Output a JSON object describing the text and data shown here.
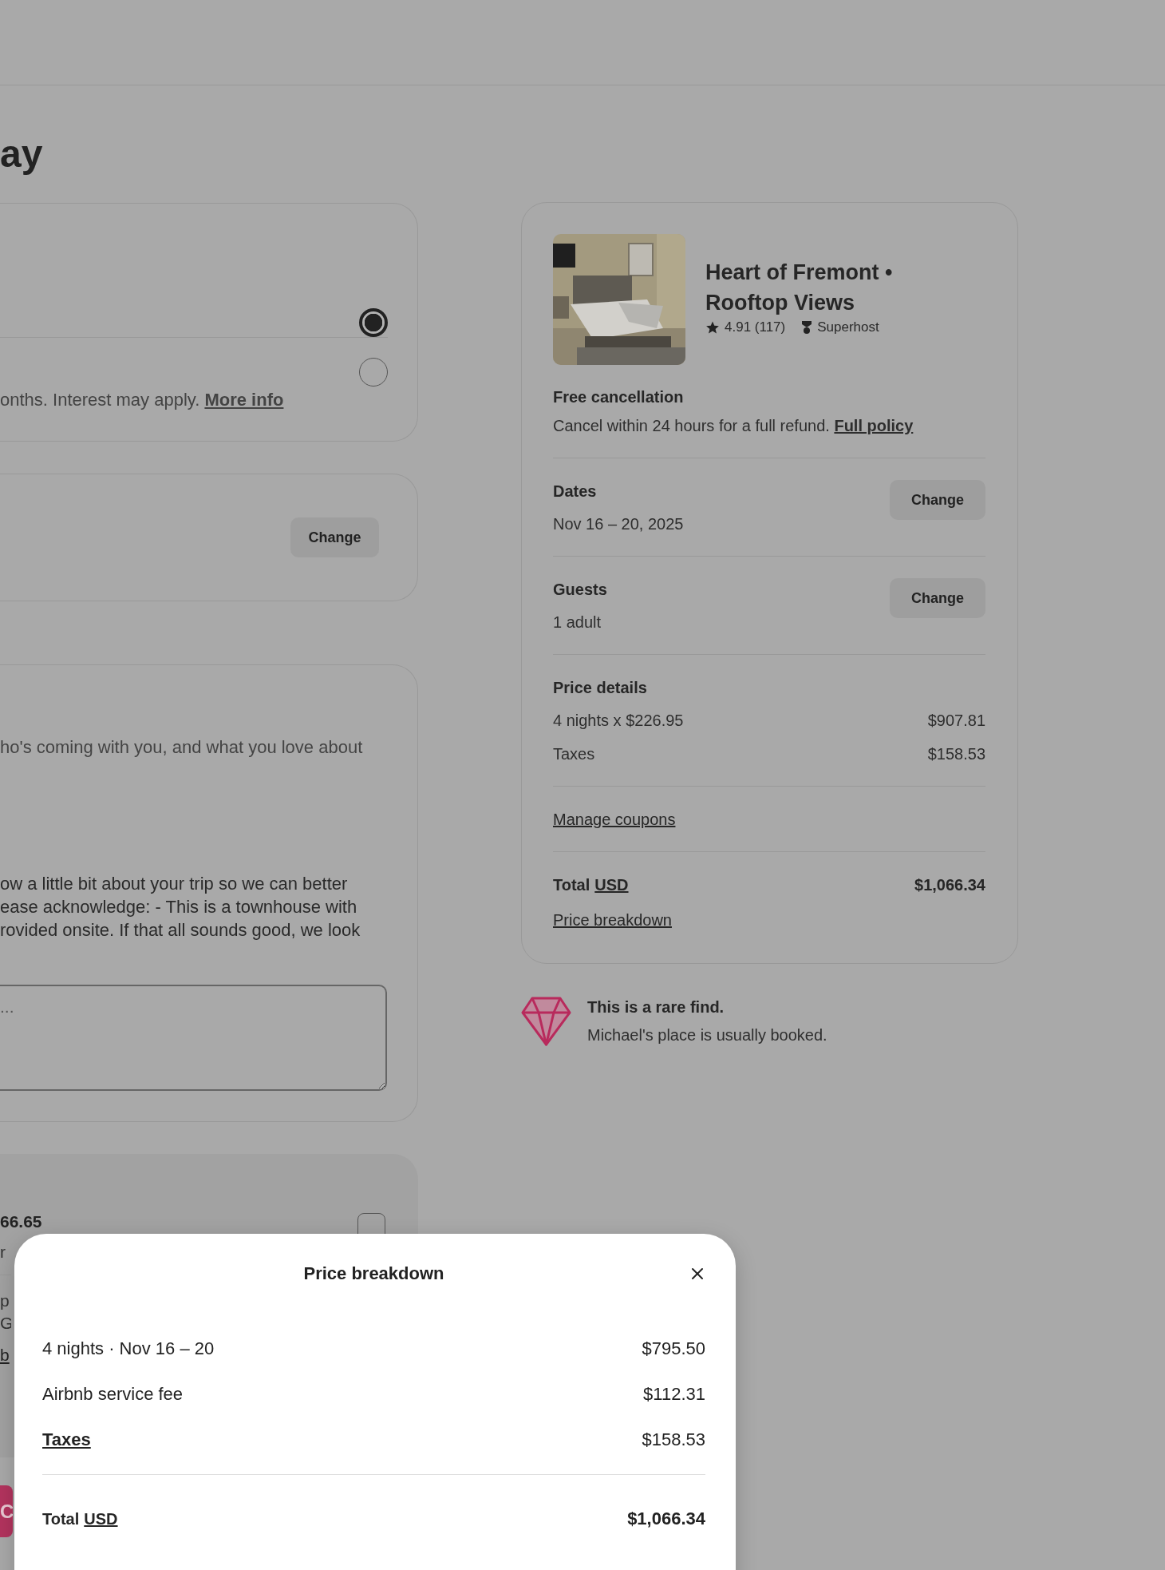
{
  "page_title": "ay",
  "payment_options": [
    {
      "selected": true
    },
    {
      "selected": false,
      "description": "onths. Interest may apply.",
      "link": "More info"
    }
  ],
  "trip_card": {
    "button": "Change"
  },
  "message_card": {
    "prompt": "ho's coming with you, and what you love about",
    "host_note": [
      "ow a little bit about your trip so we can better",
      "ease acknowledge: - This is a townhouse with",
      "rovided onsite. If that all sounds good, we look"
    ],
    "placeholder": "..."
  },
  "extra_card": {
    "amount": "66.65",
    "checked": false,
    "note": "r",
    "lines": [
      "p",
      "G"
    ],
    "link": "b"
  },
  "confirm_button": "C",
  "listing": {
    "title": "Heart of Fremont • Rooftop Views",
    "rating": "4.91 (117)",
    "badge": "Superhost"
  },
  "cancellation": {
    "title": "Free cancellation",
    "text": "Cancel within 24 hours for a full refund.",
    "link": "Full policy"
  },
  "trip_details": [
    {
      "label": "Dates",
      "value": "Nov 16 – 20, 2025",
      "button": "Change"
    },
    {
      "label": "Guests",
      "value": "1 adult",
      "button": "Change"
    }
  ],
  "price_details": {
    "title": "Price details",
    "rows": [
      {
        "label": "4 nights x $226.95",
        "amount": "$907.81"
      },
      {
        "label": "Taxes",
        "amount": "$158.53"
      }
    ]
  },
  "coupons_link": "Manage coupons",
  "total": {
    "label": "Total",
    "currency": "USD",
    "amount": "$1,066.34",
    "breakdown_link": "Price breakdown"
  },
  "rare_find": {
    "title": "This is a rare find.",
    "text": "Michael's place is usually booked."
  },
  "modal": {
    "title": "Price breakdown",
    "rows": [
      {
        "kind": "text",
        "label": "4 nights · Nov 16 – 20",
        "amount": "$795.50"
      },
      {
        "kind": "text",
        "label": "Airbnb service fee",
        "amount": "$112.31"
      },
      {
        "kind": "link",
        "label": "Taxes",
        "amount": "$158.53"
      }
    ],
    "total": {
      "label": "Total",
      "currency": "USD",
      "amount": "$1,066.34"
    }
  }
}
